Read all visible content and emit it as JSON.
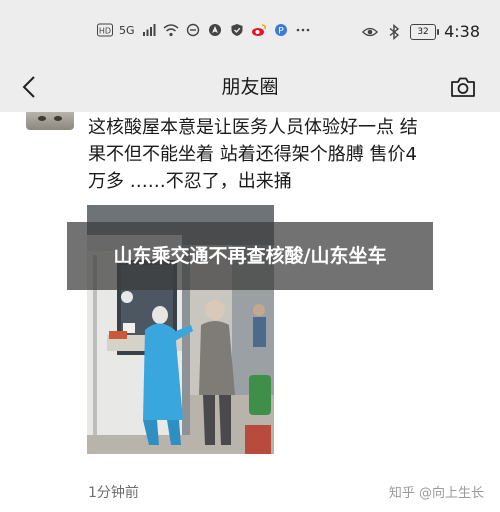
{
  "status_bar": {
    "signal_label": "5G",
    "battery_level": "32",
    "time": "4:38"
  },
  "nav": {
    "title": "朋友圈"
  },
  "post": {
    "text": "这核酸屋本意是让医务人员体验好一点 结\n果不但不能坐着 站着还得架个胳膊 售价4\n万多 ……不忍了，出来捅",
    "timestamp": "1分钟前"
  },
  "overlay": {
    "title": "山东乘交通不再查核酸/山东坐车"
  },
  "watermark": "知乎 @向上生长",
  "colors": {
    "bar_bg": "#ededed",
    "booth_blue": "#3aa6de",
    "overlay_bg": "rgba(60,60,60,0.72)"
  }
}
